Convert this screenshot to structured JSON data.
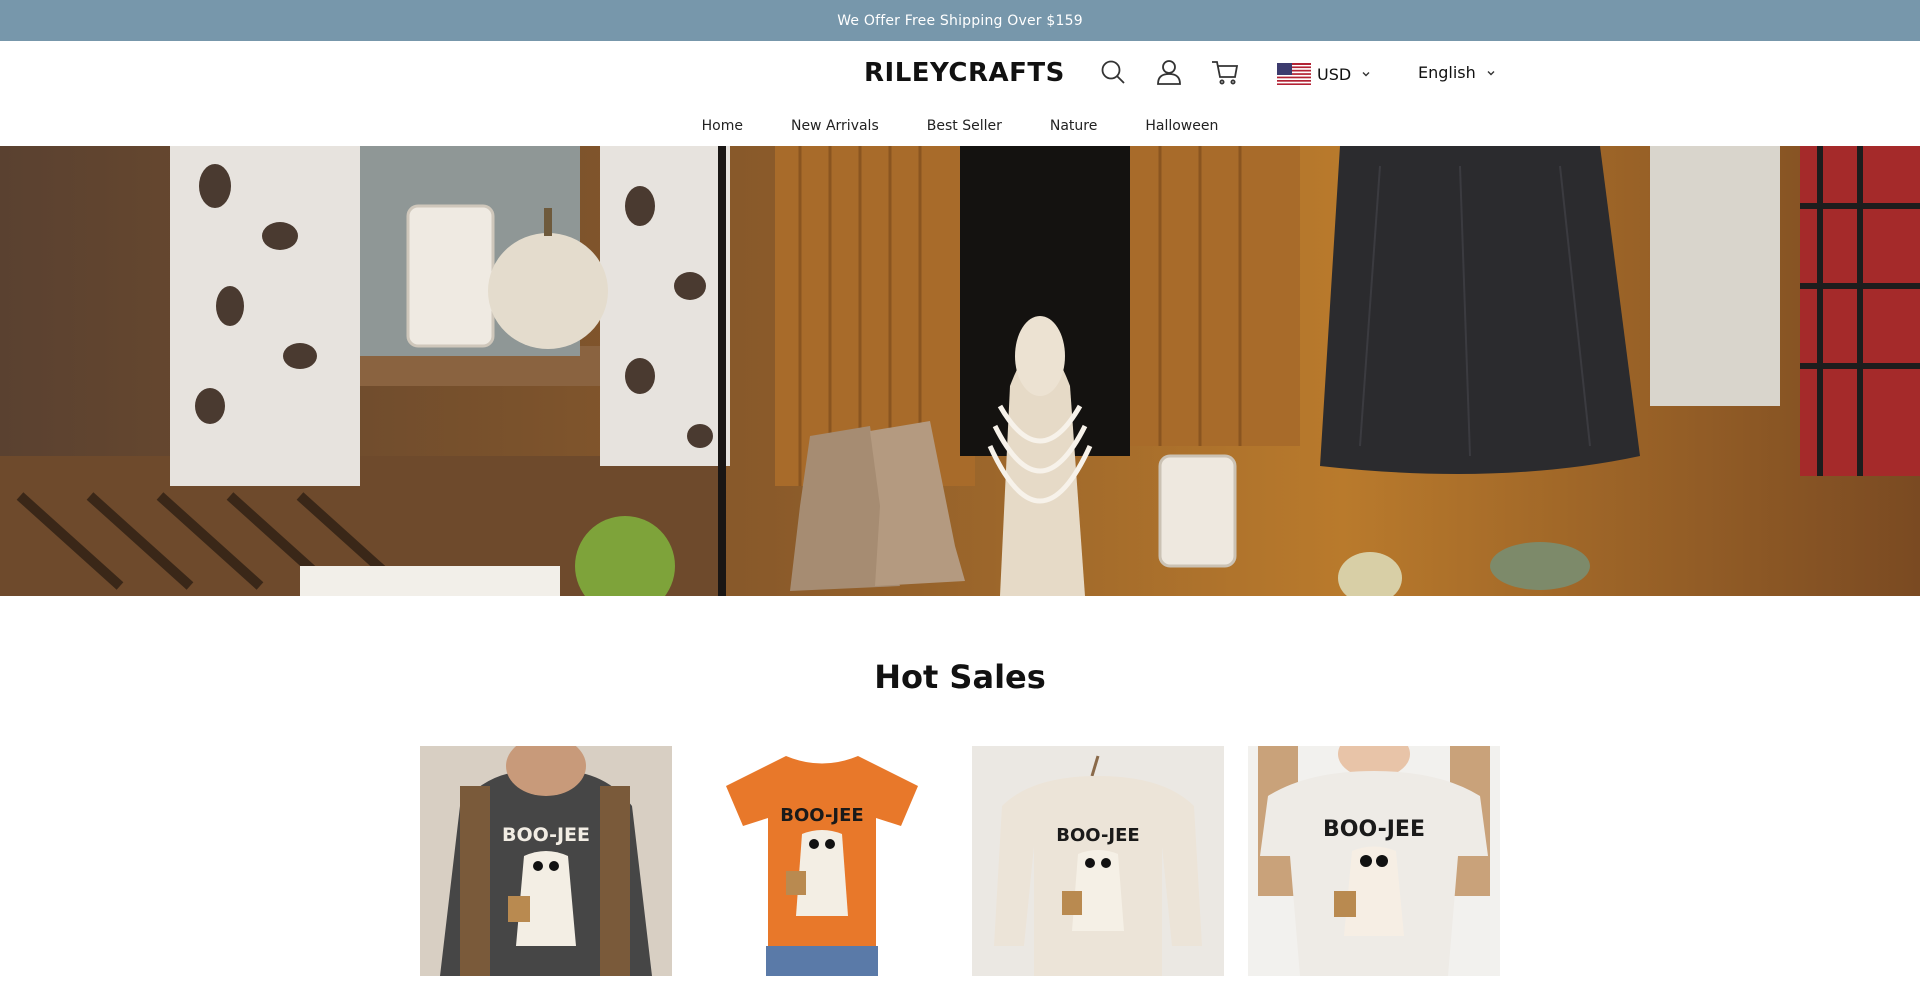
{
  "announcement": "We Offer Free Shipping Over $159",
  "header": {
    "logo": "RILEYCRAFTS",
    "currency": "USD",
    "language": "English"
  },
  "nav": [
    "Home",
    "New Arrivals",
    "Best Seller",
    "Nature",
    "Halloween"
  ],
  "section": {
    "title": "Hot Sales"
  },
  "products": [
    {
      "print": "BOO-JEE",
      "shirt_color": "#464646"
    },
    {
      "print": "BOO-JEE",
      "shirt_color": "#e8782a"
    },
    {
      "print": "BOO-JEE",
      "shirt_color": "#ece4d8"
    },
    {
      "print": "BOO-JEE",
      "shirt_color": "#eeebe6"
    }
  ]
}
